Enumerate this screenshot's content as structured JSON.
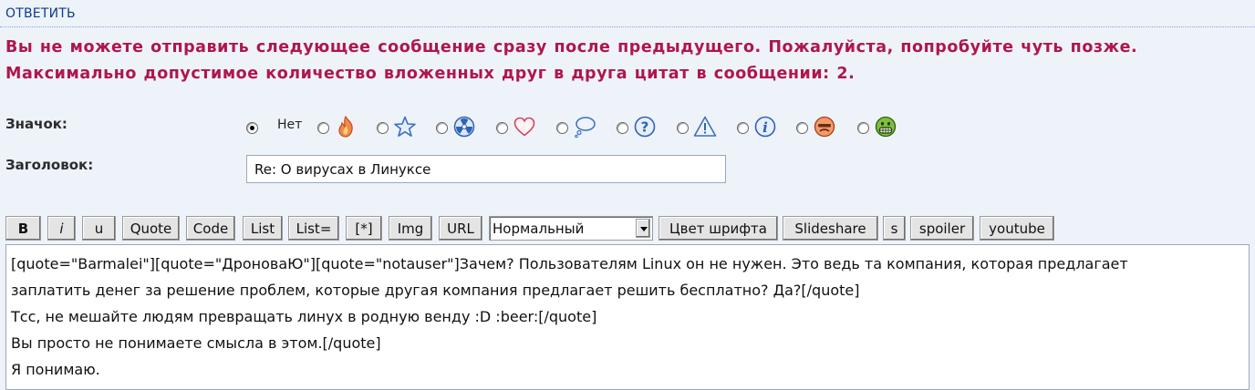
{
  "header": {
    "reply_link": "ОТВЕТИТЬ"
  },
  "errors": [
    "Вы не можете отправить следующее сообщение сразу после предыдущего. Пожалуйста, попробуйте чуть позже.",
    "Максимально допустимое количество вложенных друг в друга цитат в сообщении: 2."
  ],
  "icon_field": {
    "label": "Значок:",
    "none_label": "Нет",
    "selected": "none",
    "options": [
      "none",
      "fire-icon",
      "star-icon",
      "radioactive-icon",
      "heart-icon",
      "speech-bubble-icon",
      "question-icon",
      "warning-icon",
      "info-icon",
      "angry-face-icon",
      "grin-face-icon"
    ]
  },
  "title_field": {
    "label": "Заголовок:",
    "value": "Re: О вирусах в Линуксе"
  },
  "toolbar": {
    "buttons": [
      "B",
      "i",
      "u",
      "Quote",
      "Code",
      "List",
      "List=",
      "[*]",
      "Img",
      "URL"
    ],
    "font_size_select": "Нормальный",
    "buttons_after": [
      "Цвет шрифта",
      "Slideshare",
      "s",
      "spoiler",
      "youtube"
    ]
  },
  "message": {
    "lines": [
      "[quote=\"Barmalei\"][quote=\"ДроноваЮ\"][quote=\"notauser\"]Зачем? Пользователям Linux он не нужен. Это ведь та компания, которая предлагает",
      "заплатить денег за решение проблем, которые другая компания предлагает решить бесплатно? Да?[/quote]",
      "Тсс, не мешайте людям превращать линух в родную венду  :D  :beer:[/quote]",
      "Вы просто не понимаете смысла в этом.[/quote]",
      "Я понимаю."
    ]
  }
}
